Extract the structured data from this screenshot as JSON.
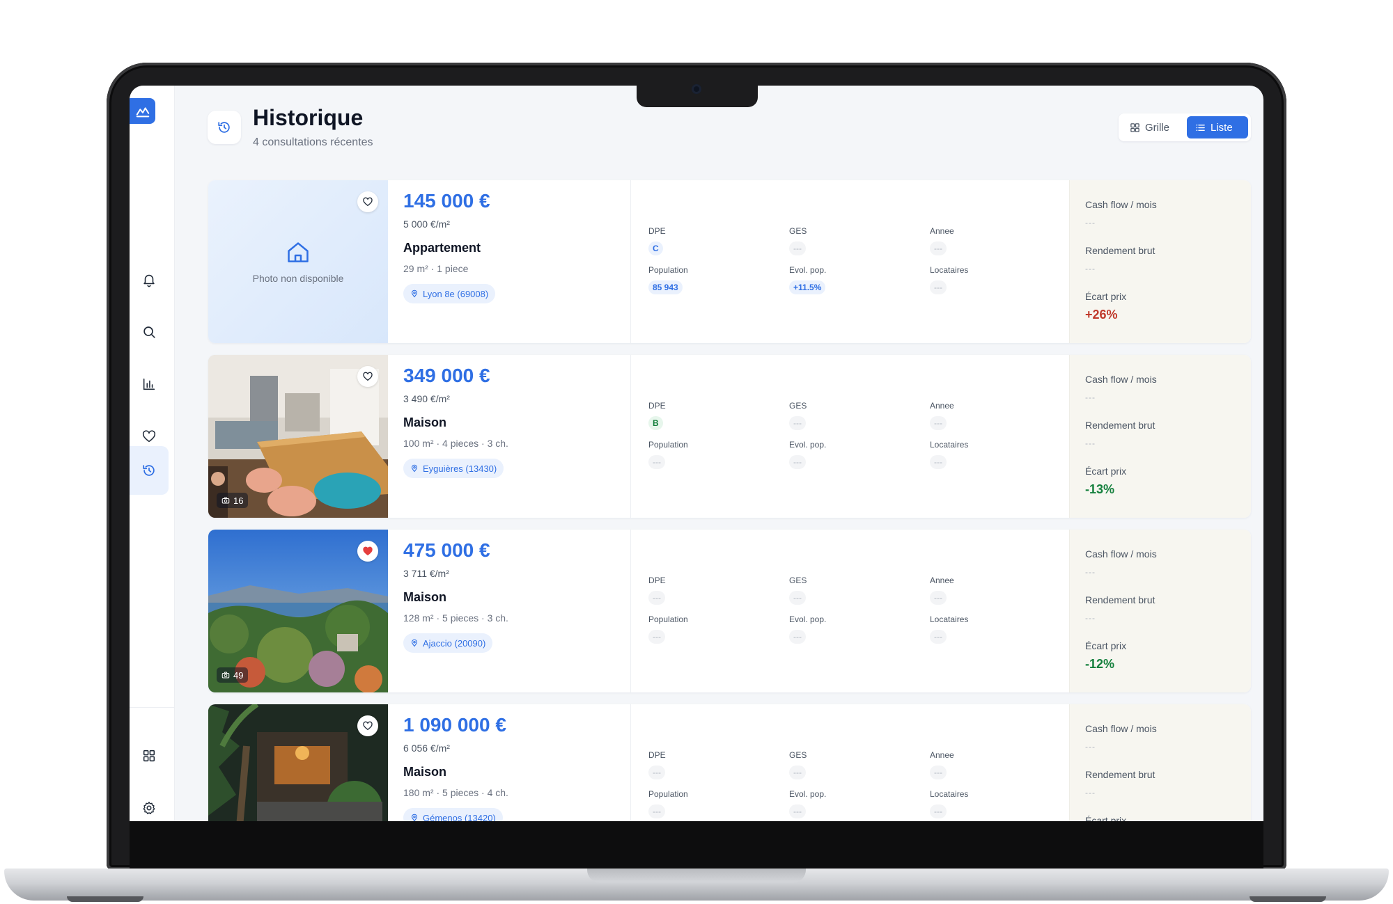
{
  "nav": {
    "items": [
      {
        "name": "bell-icon"
      },
      {
        "name": "search-icon"
      },
      {
        "name": "chart-icon"
      },
      {
        "name": "heart-icon"
      },
      {
        "name": "history-icon",
        "active": true
      }
    ],
    "bottom": [
      {
        "name": "grid-icon"
      },
      {
        "name": "gear-icon"
      }
    ]
  },
  "header": {
    "title": "Historique",
    "subtitle": "4 consultations récentes"
  },
  "view_toggle": {
    "grid_label": "Grille",
    "list_label": "Liste",
    "selected": "Liste"
  },
  "labels": {
    "dpe": "DPE",
    "ges": "GES",
    "annee": "Annee",
    "population": "Population",
    "evol_pop": "Evol. pop.",
    "locataires": "Locataires",
    "cash_flow": "Cash flow / mois",
    "rendement": "Rendement brut",
    "ecart": "Écart prix",
    "placeholder": "---",
    "no_photo": "Photo non disponible"
  },
  "colors": {
    "accent": "#2f6fe4",
    "positive_gap": "#c0392b",
    "negative_gap": "#15803d"
  },
  "listings": [
    {
      "price": "145 000 €",
      "price_m2": "5 000 €/m²",
      "type": "Appartement",
      "specs": "29 m²  ·  1 piece",
      "location": "Lyon 8e (69008)",
      "photo": false,
      "photo_count": "",
      "favorite": false,
      "dpe": "C",
      "ges": "---",
      "annee": "---",
      "population": "85 943",
      "evol_pop": "+11.5%",
      "locataires": "---",
      "cash_flow": "---",
      "rendement": "---",
      "ecart": "+26%",
      "ecart_sign": "pos"
    },
    {
      "price": "349 000 €",
      "price_m2": "3 490 €/m²",
      "type": "Maison",
      "specs": "100 m²  ·  4 pieces  ·  3 ch.",
      "location": "Eyguières (13430)",
      "photo": true,
      "photo_count": "16",
      "favorite": false,
      "dpe": "B",
      "ges": "---",
      "annee": "---",
      "population": "---",
      "evol_pop": "---",
      "locataires": "---",
      "cash_flow": "---",
      "rendement": "---",
      "ecart": "-13%",
      "ecart_sign": "neg"
    },
    {
      "price": "475 000 €",
      "price_m2": "3 711 €/m²",
      "type": "Maison",
      "specs": "128 m²  ·  5 pieces  ·  3 ch.",
      "location": "Ajaccio (20090)",
      "photo": true,
      "photo_count": "49",
      "favorite": true,
      "dpe": "---",
      "ges": "---",
      "annee": "---",
      "population": "---",
      "evol_pop": "---",
      "locataires": "---",
      "cash_flow": "---",
      "rendement": "---",
      "ecart": "-12%",
      "ecart_sign": "neg"
    },
    {
      "price": "1 090 000 €",
      "price_m2": "6 056 €/m²",
      "type": "Maison",
      "specs": "180 m²  ·  5 pieces  ·  4 ch.",
      "location": "Gémenos (13420)",
      "photo": true,
      "photo_count": "",
      "favorite": false,
      "dpe": "---",
      "ges": "---",
      "annee": "---",
      "population": "---",
      "evol_pop": "---",
      "locataires": "---",
      "cash_flow": "---",
      "rendement": "---",
      "ecart": "",
      "ecart_sign": "neg"
    }
  ]
}
